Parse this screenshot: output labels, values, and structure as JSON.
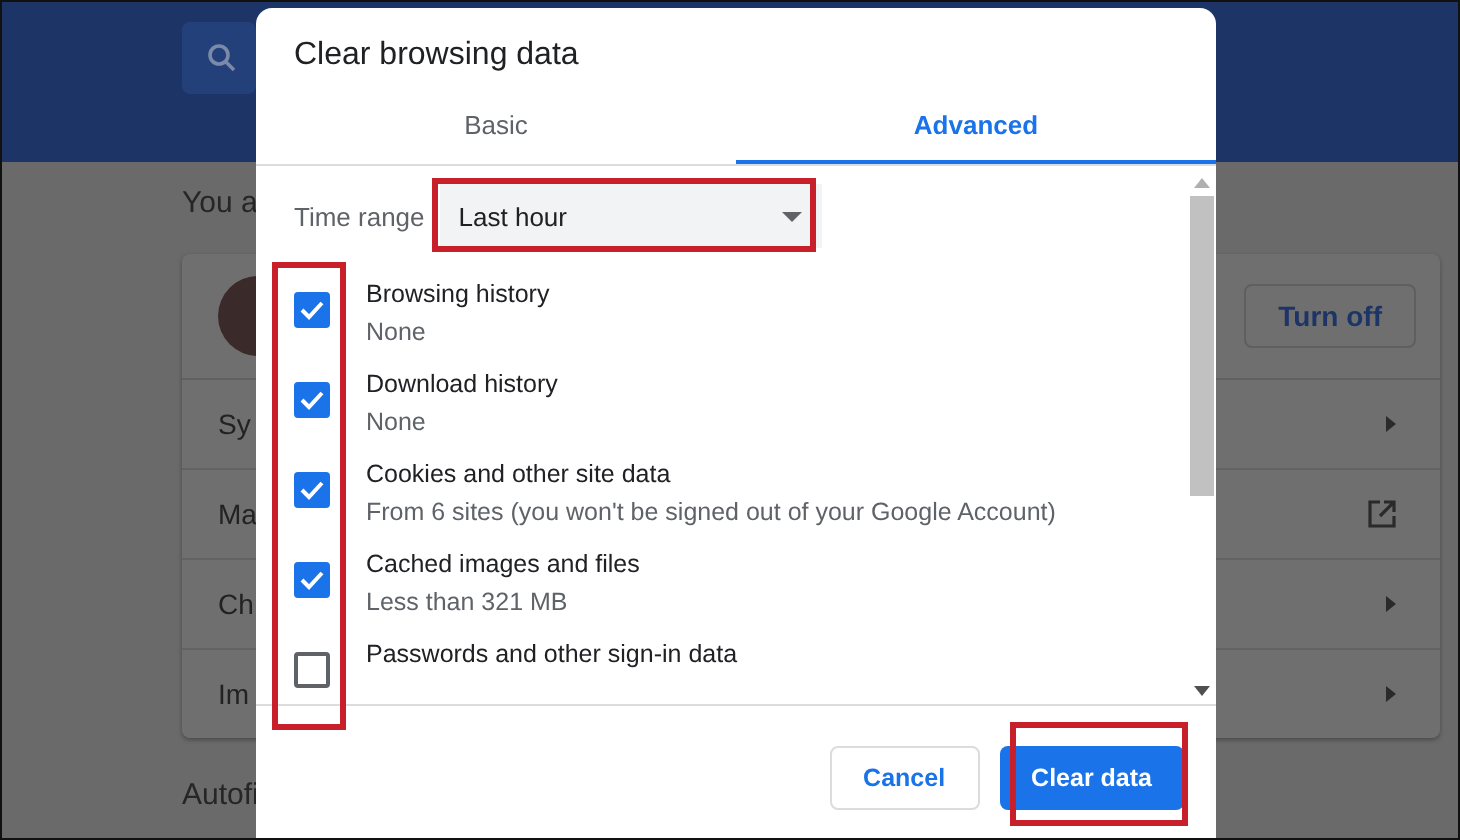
{
  "background_page": {
    "heading": "You a",
    "account_button": "Turn off",
    "rows": [
      {
        "label": "Sy",
        "kind": "arrow"
      },
      {
        "label": "Ma",
        "kind": "external"
      },
      {
        "label": "Ch",
        "kind": "arrow"
      },
      {
        "label": "Im",
        "kind": "arrow"
      }
    ],
    "section": "Autofi"
  },
  "dialog": {
    "title": "Clear browsing data",
    "tabs": [
      {
        "label": "Basic",
        "selected": false
      },
      {
        "label": "Advanced",
        "selected": true
      }
    ],
    "time_range": {
      "label": "Time range",
      "value": "Last hour"
    },
    "options": [
      {
        "label": "Browsing history",
        "detail": "None",
        "checked": true
      },
      {
        "label": "Download history",
        "detail": "None",
        "checked": true
      },
      {
        "label": "Cookies and other site data",
        "detail": "From 6 sites (you won't be signed out of your Google Account)",
        "checked": true
      },
      {
        "label": "Cached images and files",
        "detail": "Less than 321 MB",
        "checked": true
      },
      {
        "label": "Passwords and other sign-in data",
        "checked": false
      }
    ],
    "buttons": [
      {
        "label": "Cancel",
        "kind": "secondary"
      },
      {
        "label": "Clear data",
        "kind": "primary"
      }
    ]
  }
}
